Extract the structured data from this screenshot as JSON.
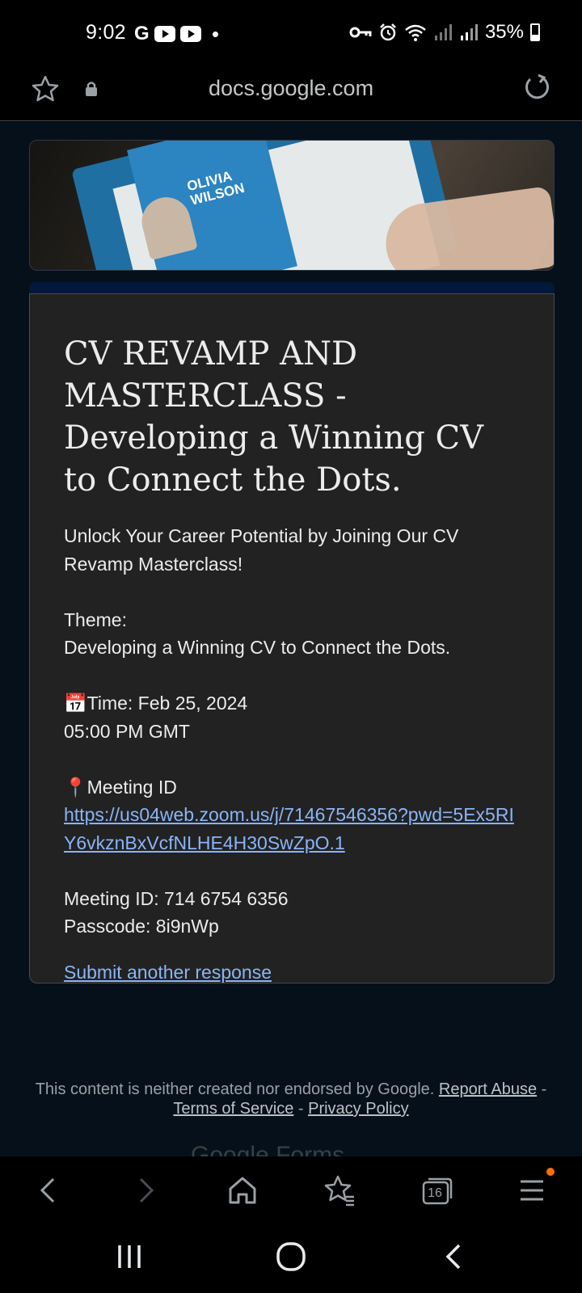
{
  "status_bar": {
    "time": "9:02",
    "google_icon_text": "G",
    "battery": "35%",
    "icons": [
      "google-icon",
      "youtube-icon",
      "youtube-icon",
      "notification-dot-icon",
      "vpn-key-icon",
      "alarm-icon",
      "wifi-icon",
      "signal-icon",
      "signal-icon",
      "battery-icon"
    ]
  },
  "browser": {
    "url": "docs.google.com",
    "icons": [
      "bookmark-star-icon",
      "lock-icon",
      "reload-icon"
    ]
  },
  "banner": {
    "name_line1": "OLIVIA",
    "name_line2": "WILSON"
  },
  "form": {
    "title": "CV REVAMP AND MASTERCLASS - Developing a Winning CV to Connect the Dots.",
    "intro": "Unlock Your Career Potential by Joining Our CV Revamp Masterclass!",
    "theme_label": "Theme:",
    "theme_value": "Developing a Winning CV to Connect the Dots.",
    "time_line": "📅Time: Feb 25, 2024",
    "time_value": "05:00 PM GMT",
    "meeting_label": "📍Meeting ID",
    "meeting_link": "https://us04web.zoom.us/j/71467546356?pwd=5Ex5RIY6vkznBxVcfNLHE4H30SwZpO.1",
    "meeting_id": "Meeting ID: 714 6754 6356",
    "passcode": "Passcode: 8i9nWp",
    "submit_another": "Submit another response"
  },
  "footer": {
    "disclaimer": "This content is neither created nor endorsed by Google.",
    "report_abuse": "Report Abuse",
    "terms": "Terms of Service",
    "privacy": "Privacy Policy",
    "separator": " - ",
    "logo_text": "Google Forms"
  },
  "bottom_toolbar": {
    "tab_count": "16",
    "icons": [
      "back-icon",
      "forward-icon",
      "home-icon",
      "bookmarks-icon",
      "tabs-icon",
      "menu-icon"
    ]
  },
  "system_nav": {
    "icons": [
      "recents-icon",
      "home-circle-icon",
      "back-icon"
    ]
  },
  "colors": {
    "link": "#8ab4f8",
    "card_bg": "#222222",
    "page_bg": "#05101a",
    "accent_bar": "#03183a",
    "menu_badge": "#ff6d00"
  }
}
